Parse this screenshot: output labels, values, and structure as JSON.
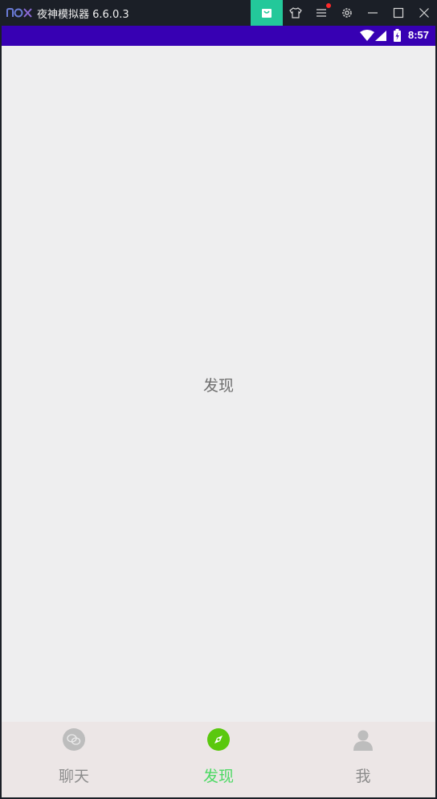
{
  "emulator": {
    "title": "夜神模拟器 6.6.0.3",
    "logo_text": "nox",
    "buttons": [
      "store-icon",
      "shirt-icon",
      "menu-icon",
      "gear-icon",
      "minimize-icon",
      "maximize-icon",
      "close-icon"
    ],
    "accent": "#23c89a"
  },
  "status_bar": {
    "time": "8:57",
    "color": "#3700b3"
  },
  "page": {
    "title": "发现"
  },
  "bottom_nav": {
    "active_color": "#4cd964",
    "items": [
      {
        "label": "聊天",
        "icon": "chat-icon",
        "active": false
      },
      {
        "label": "发现",
        "icon": "compass-icon",
        "active": true
      },
      {
        "label": "我",
        "icon": "person-icon",
        "active": false
      }
    ]
  }
}
